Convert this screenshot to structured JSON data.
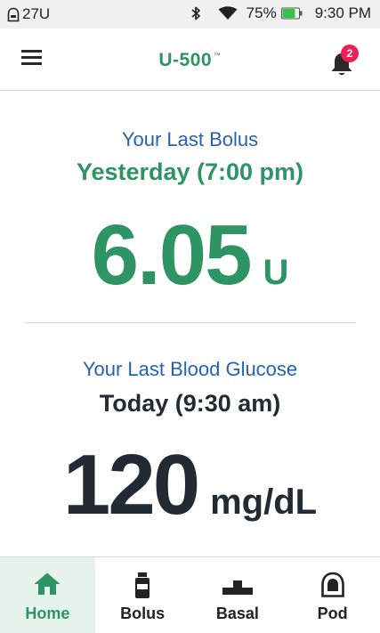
{
  "status_bar": {
    "pod_units": "27U",
    "battery": "75%",
    "time": "9:30 PM"
  },
  "header": {
    "title": "U-500",
    "trademark": "™",
    "notification_count": "2"
  },
  "bolus": {
    "label": "Your Last Bolus",
    "when": "Yesterday (7:00 pm)",
    "value": "6.05",
    "unit": "U"
  },
  "glucose": {
    "label": "Your Last Blood Glucose",
    "when": "Today (9:30 am)",
    "value": "120",
    "unit": "mg/dL"
  },
  "nav": {
    "home": "Home",
    "bolus": "Bolus",
    "basal": "Basal",
    "pod": "Pod"
  },
  "colors": {
    "accent_green": "#2f9463",
    "label_blue": "#2563ae",
    "badge_red": "#ee1f57"
  }
}
